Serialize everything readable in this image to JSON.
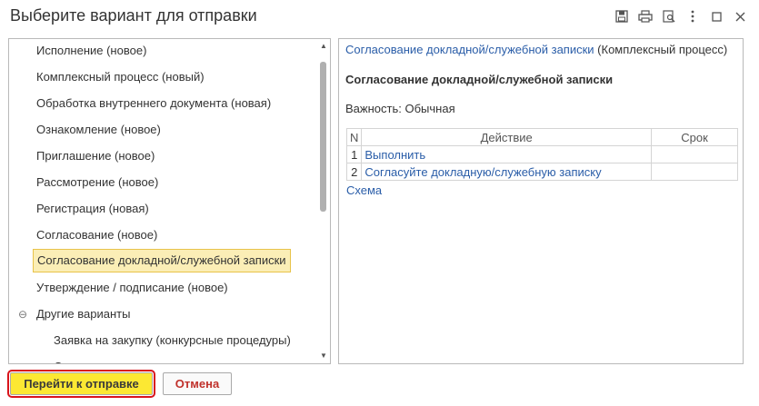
{
  "window": {
    "title": "Выберите вариант для отправки",
    "icons": [
      "save-icon",
      "print-icon",
      "preview-icon",
      "more-icon",
      "maximize-icon",
      "close-icon"
    ]
  },
  "list": {
    "items": [
      "Исполнение (новое)",
      "Комплексный процесс (новый)",
      "Обработка внутреннего документа (новая)",
      "Ознакомление (новое)",
      "Приглашение (новое)",
      "Рассмотрение (новое)",
      "Регистрация (новая)",
      "Согласование (новое)",
      "Согласование докладной/служебной записки",
      "Утверждение / подписание (новое)"
    ],
    "selected": "Согласование докладной/служебной записки",
    "group_label": "Другие варианты",
    "group_toggle": "⊖",
    "sub_items": [
      "Заявка на закупку (конкурсные процедуры)"
    ]
  },
  "details": {
    "header_link": "Согласование докладной/служебной записки",
    "header_suffix": " (Комплексный процесс)",
    "title": "Согласование докладной/служебной записки",
    "importance_label": "Важность:",
    "importance_value": "Обычная",
    "table": {
      "headers": [
        "N",
        "Действие",
        "Срок"
      ],
      "rows": [
        {
          "n": "1",
          "action": "Выполнить",
          "term": ""
        },
        {
          "n": "2",
          "action": "Согласуйте докладную/служебную записку",
          "term": ""
        }
      ]
    },
    "scheme_link": "Схема"
  },
  "buttons": {
    "send": "Перейти к отправке",
    "cancel": "Отмена"
  },
  "colors": {
    "link": "#2a5da8",
    "selected_bg": "#fbeeb6",
    "selected_border": "#e8c34a",
    "send_button_bg": "#fce833",
    "highlight_outline": "#d9141b",
    "cancel_text": "#c0312b"
  }
}
